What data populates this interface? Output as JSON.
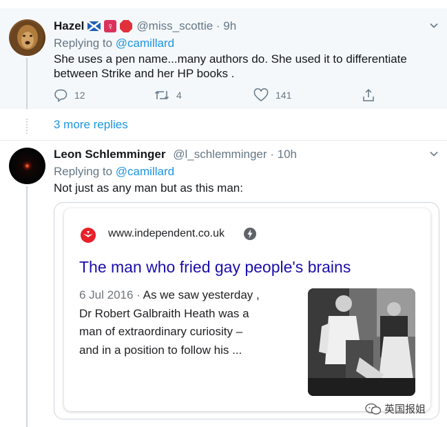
{
  "tweet1": {
    "name": "Hazel",
    "handle": "@miss_scottie · 9h",
    "replying_prefix": "Replying to",
    "replying_to": "@camillard",
    "text_line1": "She uses a pen name...many authors do. She used it to differentiate",
    "text_line2": "between Strike and her HP books .",
    "reply_count": "12",
    "retweet_count": "4",
    "like_count": "141"
  },
  "thread": {
    "more_replies": "3 more replies"
  },
  "tweet2": {
    "name": "Leon Schlemminger",
    "handle": "@l_schlemminger · 10h",
    "replying_prefix": "Replying to",
    "replying_to": "@camillard",
    "text": "Not just as any man but as this man:"
  },
  "card": {
    "url": "www.independent.co.uk",
    "title": "The man who fried gay people's brains",
    "date": "6 Jul 2016 · ",
    "snippet_line1": "As we saw yesterday ,",
    "snippet_line2": "Dr Robert Galbraith Heath was a",
    "snippet_line3": "man of extraordinary curiosity –",
    "snippet_line4": "and in a position to follow his ..."
  },
  "watermark": {
    "text": "英国报姐"
  },
  "colors": {
    "link": "#1b95e0",
    "muted": "#657786",
    "title_link": "#1a0dab",
    "highlight_bg": "#f5f8fa"
  },
  "icons": [
    "chevron-down-icon",
    "reply-icon",
    "retweet-icon",
    "like-icon",
    "share-icon",
    "independent-logo",
    "amp-bolt-icon"
  ]
}
